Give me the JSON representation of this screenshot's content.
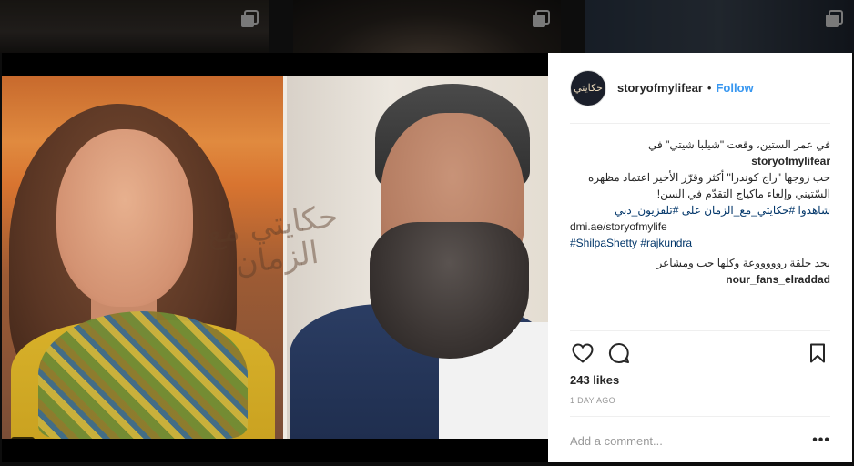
{
  "post": {
    "username": "storyofmylifear",
    "separator": "•",
    "follow_label": "Follow",
    "avatar_text": "حكايتي",
    "caption": {
      "line1": "في عمر الستين، وقعت \"شيلبا شيتي\" في",
      "line2": "حب زوجها \"راج كوندرا\" أكثر وقرّر الأخير اعتماد مظهره",
      "line3": "السّتيني وإلغاء ماكياج التقدّم في السن!",
      "line4": "شاهدوا #حكايتي_مع_الزمان على  #تلفزيون_دبي",
      "link": "dmi.ae/storyofmylife",
      "hashtags": "#ShilpaShetty #rajkundra"
    },
    "comments": [
      {
        "username": "nour_fans_elraddad",
        "text": "بجد حلقة روووووعة وكلها حب ومشاعر"
      }
    ],
    "likes": "243 likes",
    "date": "1 DAY AGO",
    "add_comment_placeholder": "Add a comment...",
    "more_label": "•••"
  },
  "photo": {
    "watermark": "حكايتي مع الزمان",
    "carousel": {
      "count": 3,
      "active_index": 0
    }
  },
  "icons": {
    "like": "heart-icon",
    "comment": "comment-icon",
    "save": "bookmark-icon",
    "multi": "multiple-posts-icon",
    "user_tag": "user-tag-icon"
  },
  "colors": {
    "accent": "#3897f0",
    "text": "#262626",
    "muted": "#999999",
    "hashtag": "#003569"
  }
}
